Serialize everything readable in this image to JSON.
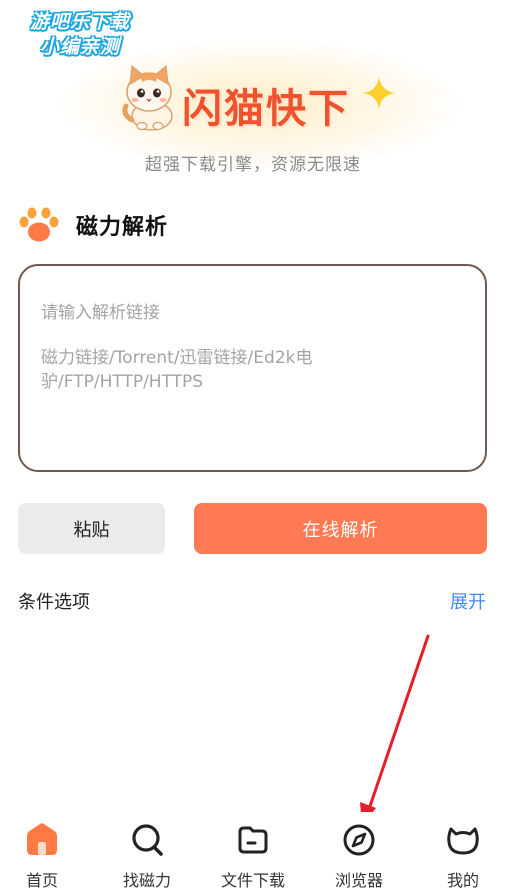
{
  "watermark": {
    "line1": "游吧乐下载",
    "line2": "小编亲测"
  },
  "header": {
    "app_title": "闪猫快下",
    "slogan": "超强下载引擎，资源无限速"
  },
  "section": {
    "title": "磁力解析",
    "icon": "paw-icon"
  },
  "input": {
    "placeholder_line1": "请输入解析链接",
    "placeholder_line2": "磁力链接/Torrent/迅雷链接/Ed2k电驴/FTP/HTTP/HTTPS"
  },
  "buttons": {
    "paste": "粘贴",
    "parse": "在线解析"
  },
  "conditions": {
    "label": "条件选项",
    "expand": "展开"
  },
  "tabs": [
    {
      "label": "首页",
      "icon": "home-icon",
      "active": true
    },
    {
      "label": "找磁力",
      "icon": "search-magnet-icon",
      "active": false
    },
    {
      "label": "文件下载",
      "icon": "folder-icon",
      "active": false
    },
    {
      "label": "浏览器",
      "icon": "compass-icon",
      "active": false
    },
    {
      "label": "我的",
      "icon": "cat-face-icon",
      "active": false
    }
  ],
  "colors": {
    "accent": "#ff7a52",
    "title": "#f0522c",
    "link": "#3d8cf0",
    "annotation_arrow": "#e3202a"
  }
}
